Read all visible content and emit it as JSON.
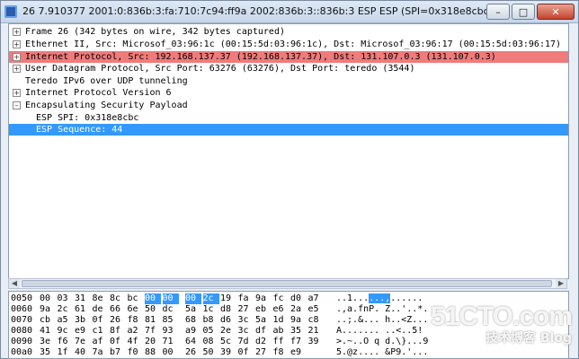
{
  "window": {
    "title": "26 7.910377 2001:0:836b:3:fa:710:7c94:ff9a 2002:836b:3::836b:3 ESP ESP (SPI=0x318e8cbc)",
    "buttons": {
      "minimize": "–",
      "maximize": "□",
      "close": "✕"
    }
  },
  "tree": [
    {
      "text": "Frame 26 (342 bytes on wire, 342 bytes captured)",
      "expander": "+"
    },
    {
      "text": "Ethernet II, Src: Microsof_03:96:1c (00:15:5d:03:96:1c), Dst: Microsof_03:96:17 (00:15:5d:03:96:17)",
      "expander": "+"
    },
    {
      "text": "Internet Protocol, Src: 192.168.137.37 (192.168.137.37), Dst: 131.107.0.3 (131.107.0.3)",
      "expander": "+"
    },
    {
      "text": "User Datagram Protocol, Src Port: 63276 (63276), Dst Port: teredo (3544)",
      "expander": "+"
    },
    {
      "text": "Teredo IPv6 over UDP tunneling",
      "expander": ""
    },
    {
      "text": "Internet Protocol Version 6",
      "expander": "+"
    },
    {
      "text": "Encapsulating Security Payload",
      "expander": "–"
    },
    {
      "text": "ESP SPI: 0x318e8cbc",
      "expander": ""
    },
    {
      "text": "ESP Sequence: 44",
      "expander": ""
    }
  ],
  "hex": [
    {
      "offset": "0050",
      "bytes": [
        "00",
        "03",
        "31",
        "8e",
        "8c",
        "bc",
        "00",
        "00",
        "00",
        "2c",
        "19",
        "fa",
        "9a",
        "fc",
        "d0",
        "a7"
      ],
      "ascii_pre": "..1...",
      "ascii_hl": "...,",
      "ascii_post": "......"
    },
    {
      "offset": "0060",
      "bytes": [
        "9a",
        "2c",
        "61",
        "de",
        "66",
        "6e",
        "50",
        "dc",
        "5a",
        "1c",
        "d8",
        "27",
        "eb",
        "e6",
        "2a",
        "e5"
      ],
      "ascii_pre": ".,a.fnP. Z..'..*.",
      "ascii_hl": "",
      "ascii_post": ""
    },
    {
      "offset": "0070",
      "bytes": [
        "cb",
        "a5",
        "3b",
        "0f",
        "26",
        "f8",
        "81",
        "85",
        "68",
        "b8",
        "d6",
        "3c",
        "5a",
        "1d",
        "9a",
        "c8"
      ],
      "ascii_pre": "..;.&... h..<Z...",
      "ascii_hl": "",
      "ascii_post": ""
    },
    {
      "offset": "0080",
      "bytes": [
        "41",
        "9c",
        "e9",
        "c1",
        "8f",
        "a2",
        "7f",
        "93",
        "a9",
        "05",
        "2e",
        "3c",
        "df",
        "ab",
        "35",
        "21"
      ],
      "ascii_pre": "A....... ..<..5!",
      "ascii_hl": "",
      "ascii_post": ""
    },
    {
      "offset": "0090",
      "bytes": [
        "3e",
        "f6",
        "7e",
        "af",
        "0f",
        "4f",
        "20",
        "71",
        "64",
        "08",
        "5c",
        "7d",
        "d2",
        "ff",
        "f7",
        "39"
      ],
      "ascii_pre": ">.~..O q d.\\}...9",
      "ascii_hl": "",
      "ascii_post": ""
    },
    {
      "offset": "00a0",
      "bytes": [
        "35",
        "1f",
        "40",
        "7a",
        "b7",
        "f0",
        "88",
        "00",
        "26",
        "50",
        "39",
        "0f",
        "27",
        "f8",
        "e9",
        "",
        "",
        ""
      ],
      "ascii_pre": "5.@z.... &P9.'...",
      "ascii_hl": "",
      "ascii_post": ""
    }
  ],
  "watermark": {
    "line1": "51CTO.com",
    "line2": "技术博客 Blog"
  }
}
